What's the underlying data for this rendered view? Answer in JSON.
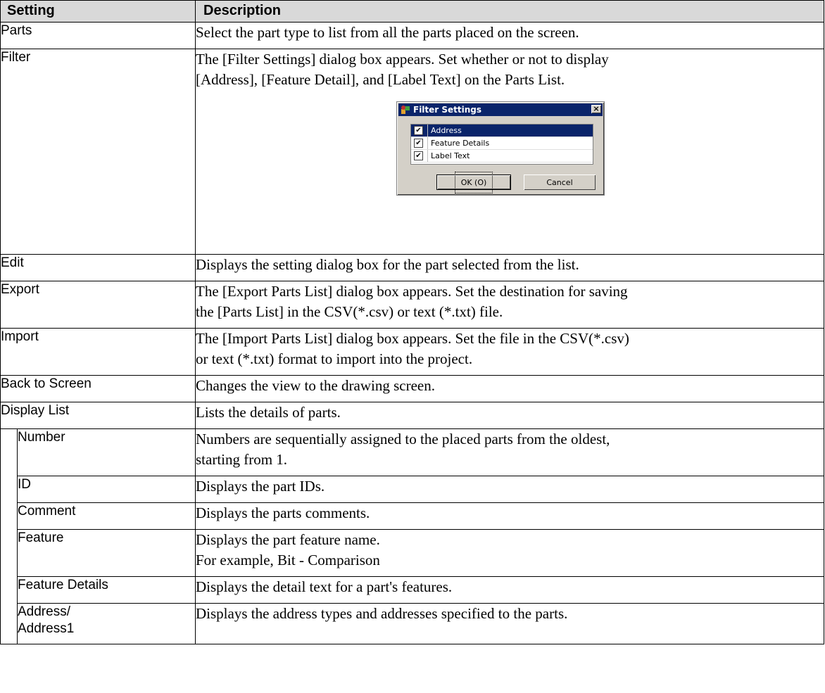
{
  "header": {
    "setting": "Setting",
    "description": "Description"
  },
  "rows": {
    "parts": {
      "setting": "Parts",
      "desc": [
        "Select the part type to list from all the parts placed on the screen."
      ]
    },
    "filter": {
      "setting": "Filter",
      "desc": [
        "The [Filter Settings] dialog box appears. Set whether or not to display",
        "[Address], [Feature Detail], and [Label Text] on the Parts List."
      ]
    },
    "edit": {
      "setting": "Edit",
      "desc": [
        "Displays the setting dialog box for the part selected from the list."
      ]
    },
    "export": {
      "setting": "Export",
      "desc": [
        "The [Export Parts List] dialog box appears. Set the destination for saving",
        "the [Parts List] in the CSV(*.csv) or text (*.txt) file."
      ]
    },
    "import": {
      "setting": "Import",
      "desc": [
        "The [Import Parts List] dialog box appears. Set the file in the CSV(*.csv)",
        "or text (*.txt) format to import into the project."
      ]
    },
    "back": {
      "setting": "Back to Screen",
      "desc": [
        "Changes the view to the drawing screen."
      ]
    },
    "display_list": {
      "setting": "Display List",
      "desc": [
        "Lists the details of parts."
      ]
    },
    "number": {
      "setting": "Number",
      "desc": [
        "Numbers are sequentially assigned to the placed parts from the oldest,",
        "starting from 1."
      ]
    },
    "id": {
      "setting": "ID",
      "desc": [
        "Displays the part IDs."
      ]
    },
    "comment": {
      "setting": "Comment",
      "desc": [
        "Displays the parts comments."
      ]
    },
    "feature": {
      "setting": "Feature",
      "desc": [
        "Displays the part feature name.",
        "For example, Bit - Comparison"
      ]
    },
    "feature_details": {
      "setting": "Feature Details",
      "desc": [
        "Displays the detail text for a part's features."
      ]
    },
    "address": {
      "setting": [
        "Address/",
        "Address1"
      ],
      "desc": [
        "Displays the address types and addresses specified to the parts."
      ]
    }
  },
  "dialog": {
    "title": "Filter Settings",
    "close_glyph": "×",
    "items": [
      {
        "label": "Address",
        "checked": true,
        "selected": true
      },
      {
        "label": "Feature Details",
        "checked": true,
        "selected": false
      },
      {
        "label": "Label Text",
        "checked": true,
        "selected": false
      }
    ],
    "check_glyph": "✔",
    "ok_label": "OK (O)",
    "cancel_label": "Cancel"
  }
}
